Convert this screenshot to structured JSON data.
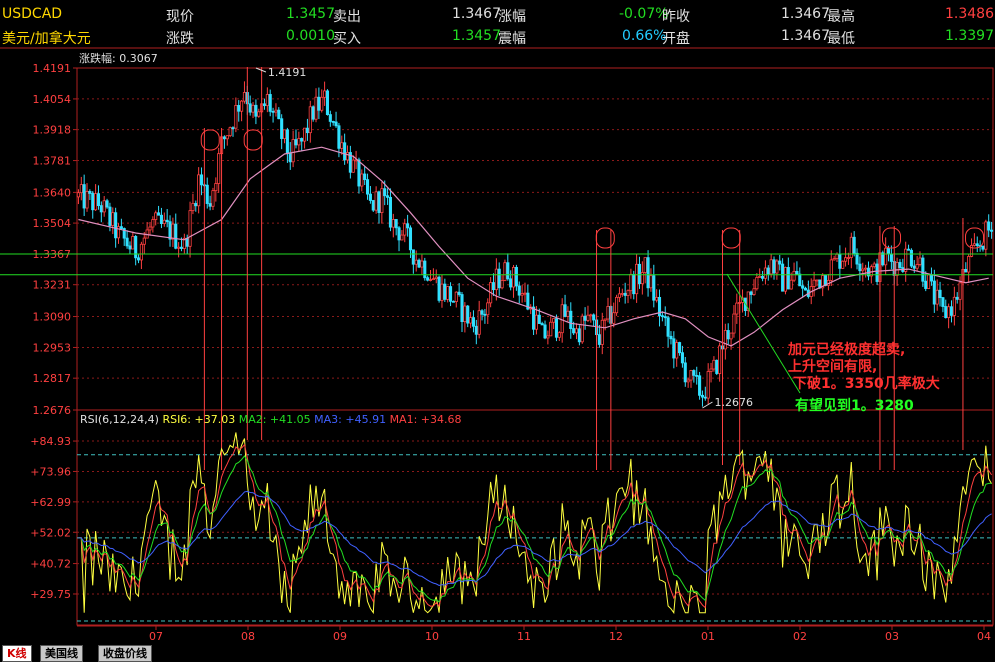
{
  "header": {
    "symbol": "USDCAD",
    "name": "美元/加拿大元",
    "row1": [
      {
        "label": "现价",
        "value": "1.3457"
      },
      {
        "label": "卖出",
        "value": "1.3467"
      },
      {
        "label": "涨幅",
        "value": "-0.07%"
      },
      {
        "label": "昨收",
        "value": "1.3467"
      },
      {
        "label": "最高",
        "value": "1.3486"
      }
    ],
    "row2": [
      {
        "label": "涨跌",
        "value": "0.0010"
      },
      {
        "label": "买入",
        "value": "1.3457"
      },
      {
        "label": "震幅",
        "value": "0.66%"
      },
      {
        "label": "开盘",
        "value": "1.3467"
      },
      {
        "label": "最低",
        "value": "1.3397"
      }
    ]
  },
  "tabs": [
    "K线",
    "美国线",
    "收盘价线"
  ],
  "chart_data": [
    {
      "type": "candlestick",
      "range_label": "涨跌幅: 0.3067",
      "y_ticks": [
        "1.4191",
        "1.4054",
        "1.3918",
        "1.3781",
        "1.3640",
        "1.3504",
        "1.3367",
        "1.3231",
        "1.3090",
        "1.2953",
        "1.2817",
        "1.2676"
      ],
      "ylim": [
        1.2676,
        1.4191
      ],
      "x_ticks": [
        "07",
        "08",
        "09",
        "10",
        "11",
        "12",
        "01",
        "02",
        "03",
        "04"
      ],
      "high_label": "1.4191",
      "low_label": "1.2676",
      "close_path": [
        [
          0,
          1.362
        ],
        [
          8,
          1.358
        ],
        [
          14,
          1.345
        ],
        [
          20,
          1.338
        ],
        [
          26,
          1.35
        ],
        [
          32,
          1.347
        ],
        [
          37,
          1.34
        ],
        [
          42,
          1.37
        ],
        [
          46,
          1.36
        ],
        [
          50,
          1.385
        ],
        [
          55,
          1.4
        ],
        [
          58,
          1.41
        ],
        [
          62,
          1.395
        ],
        [
          66,
          1.405
        ],
        [
          70,
          1.392
        ],
        [
          74,
          1.38
        ],
        [
          78,
          1.386
        ],
        [
          82,
          1.4
        ],
        [
          86,
          1.405
        ],
        [
          90,
          1.392
        ],
        [
          94,
          1.38
        ],
        [
          98,
          1.37
        ],
        [
          102,
          1.358
        ],
        [
          106,
          1.362
        ],
        [
          110,
          1.35
        ],
        [
          114,
          1.345
        ],
        [
          118,
          1.335
        ],
        [
          122,
          1.33
        ],
        [
          126,
          1.322
        ],
        [
          130,
          1.318
        ],
        [
          134,
          1.312
        ],
        [
          138,
          1.305
        ],
        [
          142,
          1.312
        ],
        [
          146,
          1.325
        ],
        [
          150,
          1.33
        ],
        [
          154,
          1.322
        ],
        [
          158,
          1.312
        ],
        [
          162,
          1.3
        ],
        [
          166,
          1.304
        ],
        [
          170,
          1.31
        ],
        [
          174,
          1.302
        ],
        [
          178,
          1.308
        ],
        [
          182,
          1.3
        ],
        [
          186,
          1.31
        ],
        [
          190,
          1.32
        ],
        [
          194,
          1.325
        ],
        [
          198,
          1.33
        ],
        [
          202,
          1.315
        ],
        [
          206,
          1.3
        ],
        [
          210,
          1.29
        ],
        [
          214,
          1.28
        ],
        [
          218,
          1.275
        ],
        [
          222,
          1.285
        ],
        [
          226,
          1.3
        ],
        [
          230,
          1.31
        ],
        [
          234,
          1.32
        ],
        [
          238,
          1.328
        ],
        [
          242,
          1.333
        ],
        [
          246,
          1.325
        ],
        [
          250,
          1.328
        ],
        [
          254,
          1.318
        ],
        [
          258,
          1.325
        ],
        [
          262,
          1.33
        ],
        [
          266,
          1.335
        ],
        [
          270,
          1.34
        ],
        [
          274,
          1.333
        ],
        [
          278,
          1.328
        ],
        [
          282,
          1.336
        ],
        [
          286,
          1.332
        ],
        [
          290,
          1.337
        ],
        [
          294,
          1.333
        ],
        [
          298,
          1.32
        ],
        [
          302,
          1.31
        ],
        [
          306,
          1.315
        ],
        [
          310,
          1.33
        ],
        [
          314,
          1.34
        ],
        [
          318,
          1.347
        ]
      ],
      "ma_path": [
        [
          0,
          1.352
        ],
        [
          20,
          1.346
        ],
        [
          37,
          1.343
        ],
        [
          50,
          1.352
        ],
        [
          60,
          1.37
        ],
        [
          72,
          1.381
        ],
        [
          85,
          1.384
        ],
        [
          96,
          1.38
        ],
        [
          106,
          1.369
        ],
        [
          116,
          1.355
        ],
        [
          126,
          1.34
        ],
        [
          136,
          1.326
        ],
        [
          146,
          1.318
        ],
        [
          160,
          1.312
        ],
        [
          172,
          1.306
        ],
        [
          184,
          1.304
        ],
        [
          194,
          1.308
        ],
        [
          204,
          1.311
        ],
        [
          212,
          1.308
        ],
        [
          220,
          1.3
        ],
        [
          228,
          1.296
        ],
        [
          236,
          1.302
        ],
        [
          246,
          1.312
        ],
        [
          256,
          1.32
        ],
        [
          266,
          1.326
        ],
        [
          278,
          1.329
        ],
        [
          290,
          1.33
        ],
        [
          300,
          1.327
        ],
        [
          310,
          1.324
        ],
        [
          318,
          1.326
        ]
      ],
      "h_lines": [
        1.3367,
        1.3275
      ],
      "annotations": [
        "加元已经极度超卖,",
        "上升空间有限,",
        "下破1。3350几率极大",
        "有望见到1。3280"
      ]
    },
    {
      "type": "line",
      "title": "RSI(6,12,24,4)",
      "series": [
        {
          "name": "RSI6",
          "last": "+37.03",
          "color": "#ffff40"
        },
        {
          "name": "MA2",
          "last": "+41.05",
          "color": "#22dd22"
        },
        {
          "name": "MA3",
          "last": "+45.91",
          "color": "#4060ff"
        },
        {
          "name": "MA1",
          "last": "+34.68",
          "color": "#ff4040"
        }
      ],
      "y_ticks": [
        "+84.93",
        "+73.96",
        "+62.99",
        "+52.02",
        "+40.72",
        "+29.75"
      ],
      "ylim": [
        20,
        90
      ],
      "dashed_levels": [
        80,
        50,
        20
      ]
    }
  ]
}
